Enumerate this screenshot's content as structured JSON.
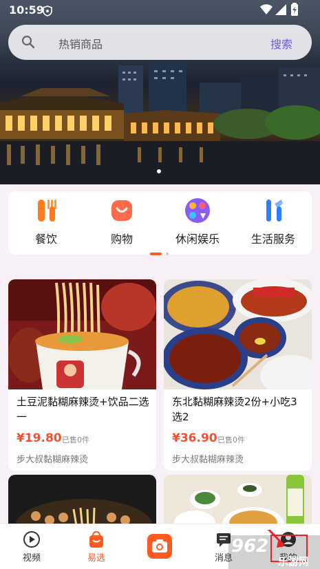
{
  "status": {
    "time": "10:59"
  },
  "search": {
    "placeholder": "热销商品",
    "button": "搜索"
  },
  "categories": [
    {
      "label": "餐饮",
      "icon": "cutlery-icon",
      "color": "#ff7a1a"
    },
    {
      "label": "购物",
      "icon": "shopping-bag-icon",
      "color": "#ff6b4a"
    },
    {
      "label": "休闲娱乐",
      "icon": "entertainment-icon",
      "color": "#8a5cf6"
    },
    {
      "label": "生活服务",
      "icon": "tools-icon",
      "color": "#2f7dff"
    }
  ],
  "products": [
    {
      "title": "土豆泥黏糊麻辣烫+饮品二选一",
      "price": "¥19.80",
      "sold": "已售0件",
      "shop": "步大叔黏糊麻辣烫"
    },
    {
      "title": "东北黏糊麻辣烫2份+小吃3选2",
      "price": "¥36.90",
      "sold": "已售0件",
      "shop": "步大叔黏糊麻辣烫"
    }
  ],
  "nav": {
    "items": [
      {
        "label": "视频",
        "icon": "play-circle-icon"
      },
      {
        "label": "易选",
        "icon": "shopping-bag-icon"
      },
      {
        "label": "",
        "icon": "camera-icon"
      },
      {
        "label": "消息",
        "icon": "message-icon"
      },
      {
        "label": "我的",
        "icon": "profile-icon"
      }
    ]
  },
  "watermark": {
    "logo": "962",
    "text": "乐游网"
  },
  "colors": {
    "accent": "#ff5a1f",
    "price": "#ff4b2b",
    "search_button": "#6f5bd6"
  }
}
